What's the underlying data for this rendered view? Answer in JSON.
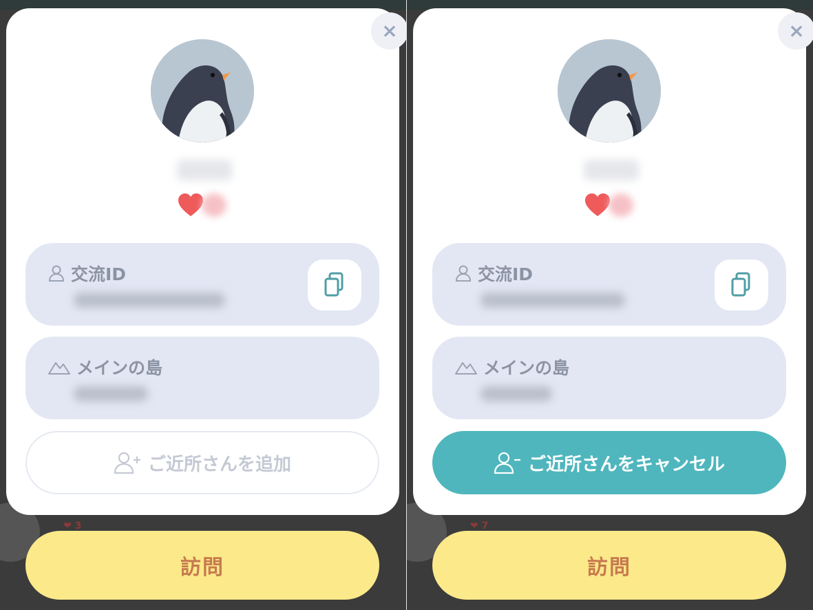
{
  "colors": {
    "accent_teal": "#4fb6bd",
    "visit_yellow": "#fbe98a",
    "visit_text": "#c7794e",
    "info_box": "#e3e7f4",
    "heart": "#ef5b5b"
  },
  "icons": {
    "close": "×",
    "user": "user-icon",
    "mountain": "mountain-icon",
    "copy": "copy-icon",
    "user_add": "user-plus-icon",
    "user_remove": "user-minus-icon",
    "heart": "heart-icon"
  },
  "left_popup": {
    "id_label": "交流ID",
    "island_label": "メインの島",
    "action_label": "ご近所さんを追加",
    "visit_label": "訪問"
  },
  "right_popup": {
    "id_label": "交流ID",
    "island_label": "メインの島",
    "action_label": "ご近所さんをキャンセル",
    "visit_label": "訪問"
  }
}
